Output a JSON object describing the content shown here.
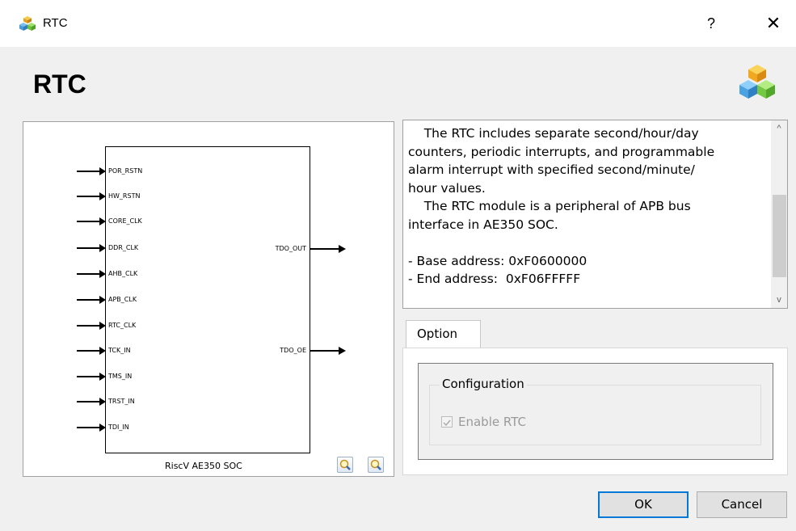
{
  "window": {
    "title": "RTC",
    "help_label": "?",
    "close_label": "✕"
  },
  "header": {
    "title": "RTC",
    "logo_icon": "cubes-icon"
  },
  "diagram": {
    "chip_name": "RiscV AE350 SOC",
    "inputs": [
      "POR_RSTN",
      "HW_RSTN",
      "CORE_CLK",
      "DDR_CLK",
      "AHB_CLK",
      "APB_CLK",
      "RTC_CLK",
      "TCK_IN",
      "TMS_IN",
      "TRST_IN",
      "TDI_IN"
    ],
    "outputs": [
      "TDO_OUT",
      "TDO_OE"
    ],
    "zoom_in_icon": "zoom-in-icon",
    "zoom_out_icon": "zoom-out-icon"
  },
  "description": {
    "text": "    The RTC includes separate second/hour/day\ncounters, periodic interrupts, and programmable\nalarm interrupt with specified second/minute/\nhour values.\n    The RTC module is a peripheral of APB bus\ninterface in AE350 SOC.\n\n- Base address: 0xF0600000\n- End address:  0xF06FFFFF"
  },
  "tabs": [
    {
      "label": "Option"
    }
  ],
  "option": {
    "group_title": "Configuration",
    "checkbox_label": "Enable RTC",
    "checkbox_checked": true,
    "checkbox_enabled": false
  },
  "buttons": {
    "ok": "OK",
    "cancel": "Cancel"
  }
}
